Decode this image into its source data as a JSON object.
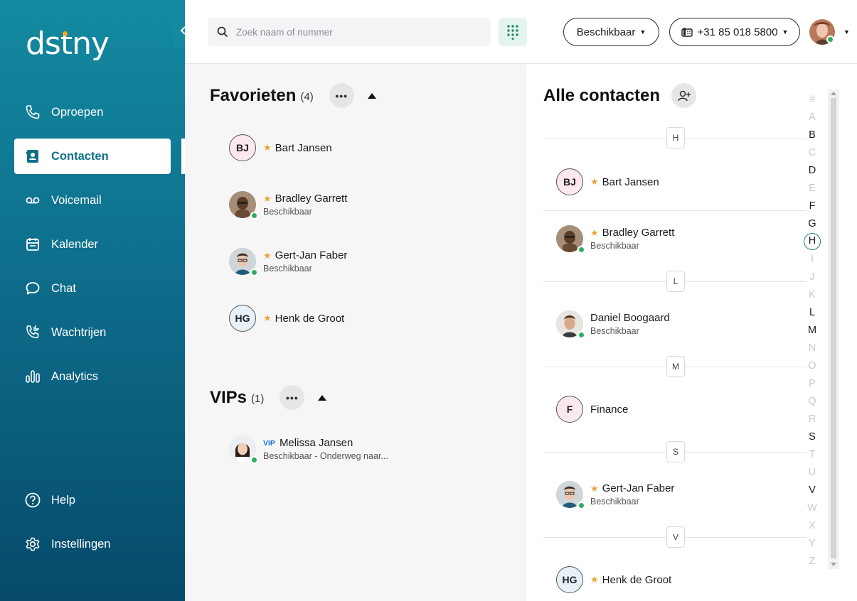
{
  "app": {
    "logo_text": "dstny"
  },
  "sidebar": {
    "items": [
      {
        "label": "Oproepen",
        "icon": "phone-icon"
      },
      {
        "label": "Contacten",
        "icon": "contact-card-icon",
        "active": true
      },
      {
        "label": "Voicemail",
        "icon": "voicemail-icon"
      },
      {
        "label": "Kalender",
        "icon": "calendar-icon"
      },
      {
        "label": "Chat",
        "icon": "chat-bubble-icon"
      },
      {
        "label": "Wachtrijen",
        "icon": "queue-phone-icon"
      },
      {
        "label": "Analytics",
        "icon": "bar-chart-icon"
      }
    ],
    "bottom_items": [
      {
        "label": "Help",
        "icon": "help-circle-icon"
      },
      {
        "label": "Instellingen",
        "icon": "gear-icon"
      }
    ]
  },
  "topbar": {
    "search_placeholder": "Zoek naam of nummer",
    "status_label": "Beschikbaar",
    "phone_number": "+31 85 018 5800"
  },
  "favorites": {
    "title": "Favorieten",
    "count": "(4)",
    "contacts": [
      {
        "initials": "BJ",
        "name": "Bart Jansen",
        "status": ""
      },
      {
        "name": "Bradley Garrett",
        "status": "Beschikbaar"
      },
      {
        "name": "Gert-Jan Faber",
        "status": "Beschikbaar"
      },
      {
        "initials": "HG",
        "name": "Henk de Groot",
        "status": ""
      }
    ]
  },
  "vips": {
    "title": "VIPs",
    "count": "(1)",
    "contacts": [
      {
        "badge": "VIP",
        "name": "Melissa Jansen",
        "status": "Beschikbaar - Onderweg naar..."
      }
    ]
  },
  "all_contacts": {
    "title": "Alle contacten",
    "groups": [
      {
        "letter": "H",
        "contacts": [
          {
            "initials": "BJ",
            "name": "Bart Jansen",
            "status": ""
          },
          {
            "name": "Bradley Garrett",
            "status": "Beschikbaar"
          }
        ]
      },
      {
        "letter": "L",
        "contacts": [
          {
            "name": "Daniel Boogaard",
            "status": "Beschikbaar"
          }
        ]
      },
      {
        "letter": "M",
        "contacts": [
          {
            "initials": "F",
            "name": "Finance",
            "status": ""
          }
        ]
      },
      {
        "letter": "S",
        "contacts": [
          {
            "name": "Gert-Jan Faber",
            "status": "Beschikbaar"
          }
        ]
      },
      {
        "letter": "V",
        "contacts": [
          {
            "initials": "HG",
            "name": "Henk de Groot",
            "status": ""
          }
        ]
      }
    ],
    "alphabet": [
      "#",
      "A",
      "B",
      "C",
      "D",
      "E",
      "F",
      "G",
      "H",
      "I",
      "J",
      "K",
      "L",
      "M",
      "N",
      "O",
      "P",
      "Q",
      "R",
      "S",
      "T",
      "U",
      "V",
      "W",
      "X",
      "Y",
      "Z"
    ],
    "alphabet_enabled": [
      "B",
      "D",
      "F",
      "G",
      "H",
      "L",
      "M",
      "S",
      "V"
    ],
    "alphabet_selected": "H"
  },
  "colors": {
    "accent": "#0d7088",
    "star": "#e9a53b",
    "online": "#2fae63",
    "vip": "#1a6fd1"
  }
}
